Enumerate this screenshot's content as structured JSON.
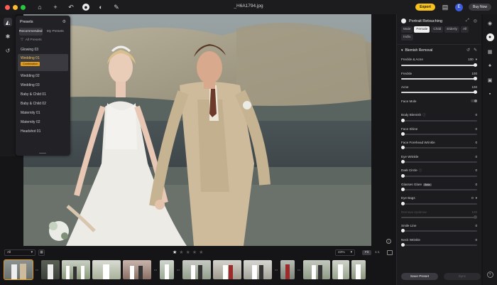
{
  "window": {
    "title": "_H6A1794.jpg"
  },
  "topbar": {
    "export_label": "Export",
    "buy_label": "Buy Now",
    "avatar_letter": "E"
  },
  "presets": {
    "title": "Presets",
    "tabs": [
      "Recommended",
      "My Presets"
    ],
    "all_label": "All Presets",
    "items": [
      "Glowing 03",
      "Wedding 01",
      "Wedding 02",
      "Wedding 03",
      "Baby & Child 01",
      "Baby & Child 02",
      "Maternity 01",
      "Maternity 02",
      "Headshot 01"
    ],
    "selected_index": 1,
    "selected_badge": "Combination"
  },
  "panel": {
    "title": "Portrait Retouching",
    "gender_tabs": [
      "Male",
      "Female",
      "Child",
      "Elderly",
      "All",
      "Indiv."
    ],
    "gender_selected": "Female",
    "section_title": "Blemish Removal",
    "sliders": [
      {
        "label": "Freckle & Acne",
        "value": "100",
        "level": 1.0,
        "chevron": true
      },
      {
        "label": "Freckle",
        "value": "100",
        "level": 1.0
      },
      {
        "label": "Acne",
        "value": "100",
        "level": 1.0
      },
      {
        "label": "Face Mole",
        "value": "",
        "toggle": true,
        "level": null
      },
      {
        "label": "Body Blemish",
        "value": "0",
        "level": 0,
        "info": true
      },
      {
        "label": "Face Shine",
        "value": "0",
        "level": 0
      },
      {
        "label": "Face Forehead Wrinkle",
        "value": "0",
        "level": 0
      },
      {
        "label": "Eye Wrinkle",
        "value": "0",
        "level": 0
      },
      {
        "label": "Dark Circle",
        "value": "0",
        "level": 0,
        "info": true
      },
      {
        "label": "Glasses Glare",
        "value": "0",
        "level": 0,
        "beta": "Beta"
      },
      {
        "label": "Eye Bags",
        "value": "0",
        "level": 0,
        "chevron": true
      },
      {
        "label": "Remove eyebrow",
        "value": "100",
        "level": 1.0,
        "dim": true
      },
      {
        "label": "Smile Line",
        "value": "0",
        "level": 0
      },
      {
        "label": "Neck Wrinkle",
        "value": "0",
        "level": 0
      }
    ],
    "save_label": "Save Preset",
    "sync_label": "Sync"
  },
  "filmstrip": {
    "filter_value": "All",
    "rating": 1,
    "zoom": "43%",
    "fit_label": "Fit",
    "one_label": "1:1"
  },
  "colors": {
    "accent": "#e39b1a",
    "export": "#f6c21b",
    "avatar": "#3b5bdb"
  }
}
